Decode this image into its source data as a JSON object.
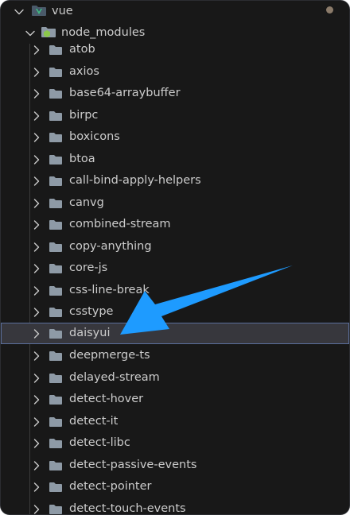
{
  "explorer": {
    "root": {
      "label": "vue",
      "expanded": true,
      "icon": "vue-folder-icon"
    },
    "node_modules": {
      "label": "node_modules",
      "expanded": true,
      "icon": "node-modules-folder-icon"
    },
    "items": [
      {
        "label": "atob"
      },
      {
        "label": "axios"
      },
      {
        "label": "base64-arraybuffer"
      },
      {
        "label": "birpc"
      },
      {
        "label": "boxicons"
      },
      {
        "label": "btoa"
      },
      {
        "label": "call-bind-apply-helpers"
      },
      {
        "label": "canvg"
      },
      {
        "label": "combined-stream"
      },
      {
        "label": "copy-anything"
      },
      {
        "label": "core-js"
      },
      {
        "label": "css-line-break"
      },
      {
        "label": "csstype"
      },
      {
        "label": "daisyui",
        "selected": true
      },
      {
        "label": "deepmerge-ts"
      },
      {
        "label": "delayed-stream"
      },
      {
        "label": "detect-hover"
      },
      {
        "label": "detect-it"
      },
      {
        "label": "detect-libc"
      },
      {
        "label": "detect-passive-events"
      },
      {
        "label": "detect-pointer"
      },
      {
        "label": "detect-touch-events"
      }
    ]
  },
  "colors": {
    "background": "#181818",
    "text": "#cccccc",
    "selected_background": "#37373d",
    "selected_border": "#5a6e9c",
    "folder": "#8e9aa6",
    "vue_green": "#41b883",
    "vue_dark": "#35495e",
    "modified_dot": "#8b7b6a",
    "arrow": "#1e9bff"
  }
}
